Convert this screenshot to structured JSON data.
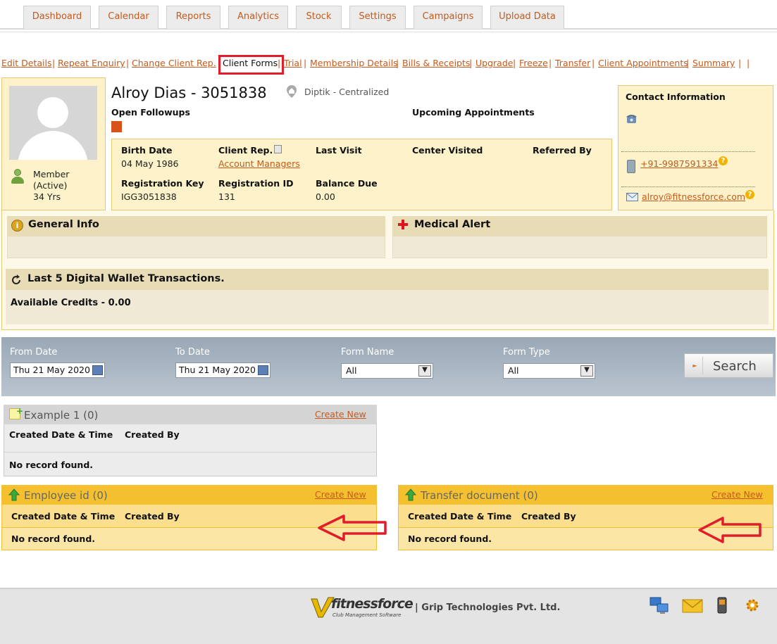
{
  "tabs": [
    "Dashboard",
    "Calendar",
    "Reports",
    "Analytics",
    "Stock",
    "Settings",
    "Campaigns",
    "Upload Data"
  ],
  "sublinks": [
    "Edit Details",
    "Repeat Enquiry",
    "Change Client Rep.",
    "Client Forms",
    "Trial",
    "Membership Details",
    "Bills & Receipts",
    "Upgrade",
    "Freeze",
    "Transfer",
    "Client Appointments",
    "Summary"
  ],
  "client": {
    "name": "Alroy Dias - 3051838",
    "center": "Diptik - Centralized",
    "status_line1": "Member",
    "status_line2": "(Active)",
    "age": "34 Yrs",
    "open_followups": "Open Followups",
    "upcoming_appointments": "Upcoming Appointments"
  },
  "details": {
    "birth_date_label": "Birth Date",
    "birth_date": "04 May 1986",
    "client_rep_label": "Client Rep.",
    "client_rep": "Account Managers",
    "last_visit_label": "Last Visit",
    "center_visited_label": "Center Visited",
    "referred_by_label": "Referred By",
    "reg_key_label": "Registration Key",
    "reg_key": "IGG3051838",
    "reg_id_label": "Registration ID",
    "reg_id": "131",
    "balance_label": "Balance Due",
    "balance": "0.00"
  },
  "contact": {
    "title": "Contact Information",
    "phone": "+91-9987591334",
    "email": "alroy@fitnessforce.com"
  },
  "general_info": "General Info",
  "medical_alert": "Medical Alert",
  "wallet": {
    "title": "Last 5 Digital Wallet Transactions.",
    "credits": "Available Credits - 0.00"
  },
  "filters": {
    "from_label": "From Date",
    "from_value": "Thu 21 May 2020",
    "to_label": "To Date",
    "to_value": "Thu 21 May 2020",
    "form_name_label": "Form Name",
    "form_name_value": "All",
    "form_type_label": "Form Type",
    "form_type_value": "All",
    "search": "Search"
  },
  "forms": {
    "example": {
      "title": "Example 1 (0)",
      "create": "Create New",
      "col1": "Created Date & Time",
      "col2": "Created By",
      "empty": "No record found."
    },
    "employee": {
      "title": "Employee id (0)",
      "create": "Create New",
      "col1": "Created Date & Time",
      "col2": "Created By",
      "empty": "No record found."
    },
    "transfer": {
      "title": "Transfer document (0)",
      "create": "Create New",
      "col1": "Created Date & Time",
      "col2": "Created By",
      "empty": "No record found."
    }
  },
  "footer": {
    "logo_text": "fitnessforce",
    "logo_sub": "Club Management Software",
    "company": "| Grip Technologies Pvt. Ltd."
  },
  "colors": {
    "accent": "#c65a1c",
    "highlight": "#e01d2b",
    "section_yellow": "#f4c030"
  }
}
